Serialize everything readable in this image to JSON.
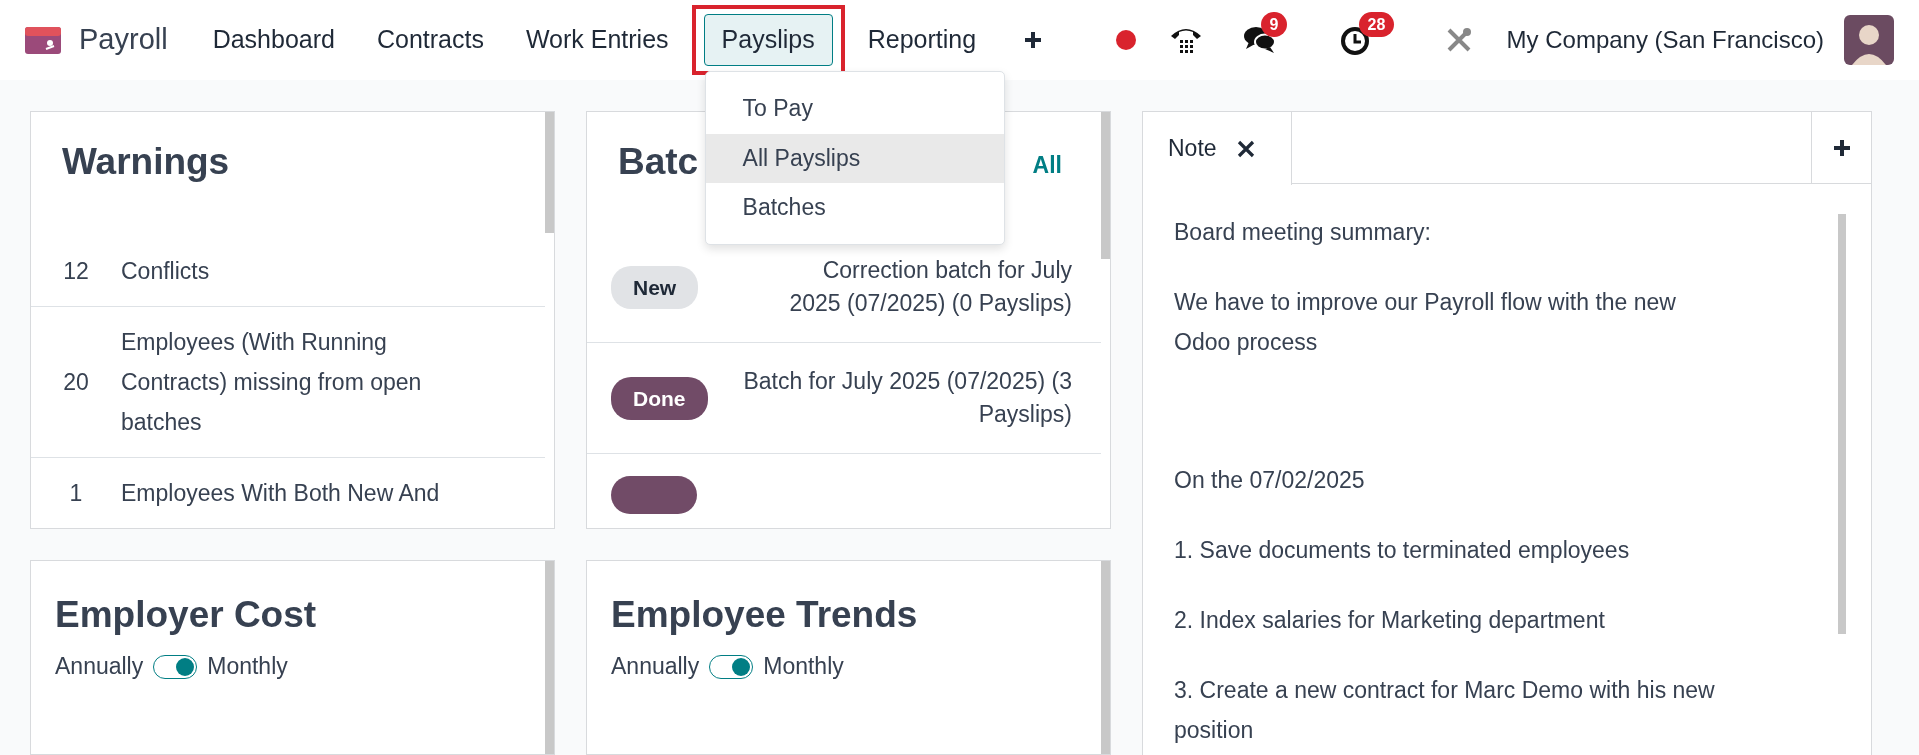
{
  "app": {
    "name": "Payroll"
  },
  "menu": [
    {
      "label": "Dashboard",
      "selected": false
    },
    {
      "label": "Contracts",
      "selected": false
    },
    {
      "label": "Work Entries",
      "selected": false
    },
    {
      "label": "Payslips",
      "selected": true
    },
    {
      "label": "Reporting",
      "selected": false
    }
  ],
  "dropdown": [
    {
      "label": "To Pay",
      "selected": false
    },
    {
      "label": "All Payslips",
      "selected": true
    },
    {
      "label": "Batches",
      "selected": false
    }
  ],
  "systray": {
    "messages_count": "9",
    "activities_count": "28",
    "company": "My Company (San Francisco)"
  },
  "warnings": {
    "title": "Warnings",
    "rows": [
      {
        "count": "12",
        "label": "Conflicts"
      },
      {
        "count": "20",
        "label": "Employees (With Running Contracts) missing from open batches"
      },
      {
        "count": "1",
        "label": "Employees With Both New And"
      }
    ]
  },
  "batches": {
    "title": "Batc",
    "link": "All",
    "rows": [
      {
        "kind": "new",
        "status": "New",
        "name": "Correction batch for July 2025 (07/2025) (0 Payslips)"
      },
      {
        "kind": "done",
        "status": "Done",
        "name": "Batch for July 2025 (07/2025) (3 Payslips)"
      },
      {
        "kind": "done"
      }
    ]
  },
  "employer_cost": {
    "title": "Employer Cost",
    "left": "Annually",
    "right": "Monthly",
    "on": true
  },
  "employee_trends": {
    "title": "Employee Trends",
    "left": "Annually",
    "right": "Monthly",
    "on": true
  },
  "note": {
    "tab": "Note",
    "paragraphs": [
      {
        "kind": "text",
        "text": "Board meeting summary:"
      },
      {
        "kind": "text",
        "text": "We have to improve our Payroll flow with the new Odoo process"
      },
      {
        "kind": "spaced",
        "text": "On the 07/02/2025"
      },
      {
        "kind": "text",
        "text": "1. Save documents to terminated employees"
      },
      {
        "kind": "text",
        "text": "2. Index salaries for Marketing department"
      },
      {
        "kind": "text",
        "text": "3. Create a new contract for Marc Demo with his new position"
      }
    ]
  }
}
